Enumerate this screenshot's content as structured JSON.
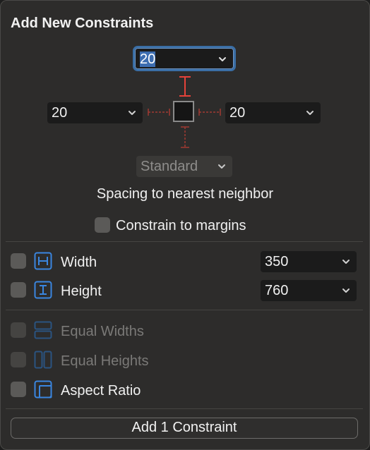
{
  "title": "Add New Constraints",
  "spacing": {
    "top_value": "20",
    "left_value": "20",
    "right_value": "20",
    "bottom_value": "Standard",
    "caption": "Spacing to nearest neighbor",
    "margins_label": "Constrain to margins"
  },
  "size": {
    "width_label": "Width",
    "width_value": "350",
    "height_label": "Height",
    "height_value": "760"
  },
  "equal": {
    "widths_label": "Equal Widths",
    "heights_label": "Equal Heights",
    "aspect_label": "Aspect Ratio"
  },
  "add_button_label": "Add 1 Constraint",
  "colors": {
    "accent": "#3d6db0",
    "constraint_red": "#e5423a",
    "icon_blue": "#3a86e0",
    "panel_bg": "#2d2c2b"
  }
}
